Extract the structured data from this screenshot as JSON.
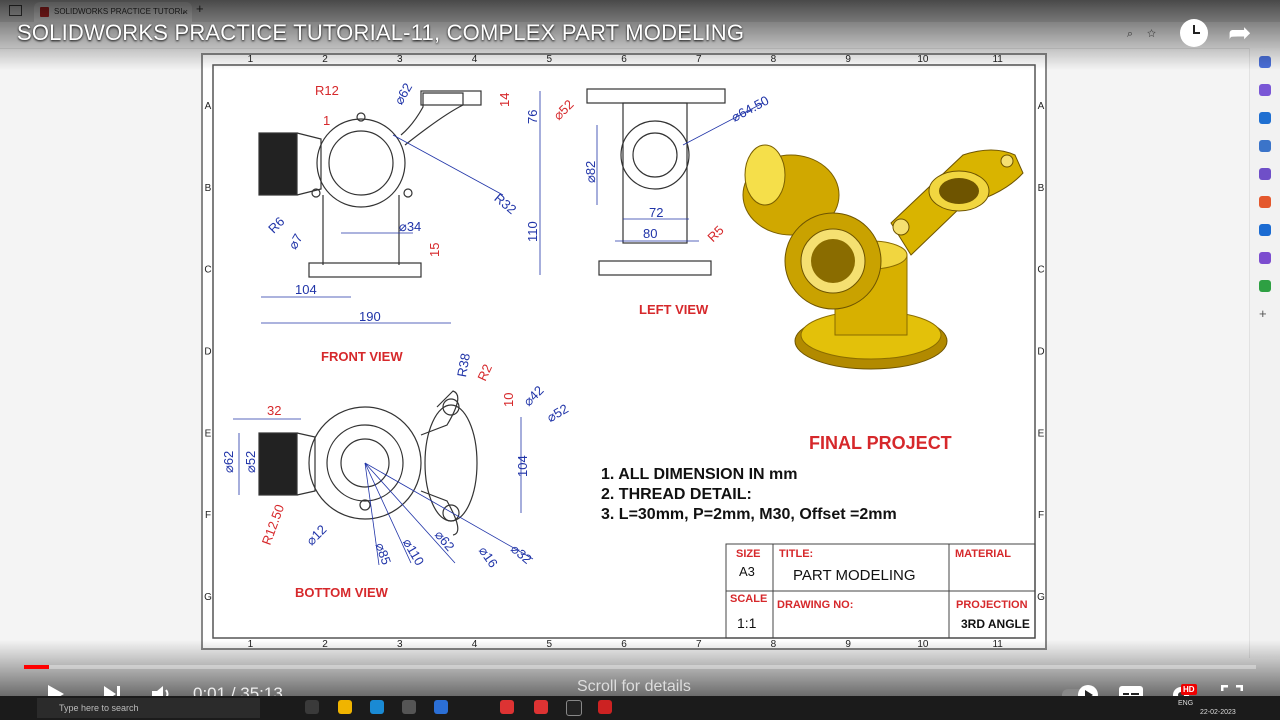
{
  "browser": {
    "tab_title": "SOLIDWORKS PRACTICE TUTORIAL",
    "tab_close": "×",
    "new_tab": "+"
  },
  "video": {
    "title": "SOLIDWORKS PRACTICE TUTORIAL-11, COMPLEX PART MODELING",
    "current_time": "0:01",
    "duration": "35:13",
    "time_separator": " / ",
    "progress_fraction": 0.02,
    "scroll_hint": "Scroll for details",
    "hd_badge": "HD",
    "accent": "#ff0000"
  },
  "drawing": {
    "column_numbers": [
      "1",
      "2",
      "3",
      "4",
      "5",
      "6",
      "7",
      "8",
      "9",
      "10",
      "11"
    ],
    "row_letters": [
      "A",
      "B",
      "C",
      "D",
      "E",
      "F",
      "G"
    ],
    "views": {
      "front": "FRONT VIEW",
      "left": "LEFT VIEW",
      "bottom": "BOTTOM VIEW"
    },
    "dims_front": [
      "R12",
      "⌀62",
      "14",
      "76",
      "R32",
      "110",
      "15",
      "⌀34",
      "R6",
      "⌀7",
      "104",
      "190",
      "1"
    ],
    "dims_left": [
      "⌀52",
      "⌀64.50",
      "⌀82",
      "72",
      "80",
      "R5"
    ],
    "dims_bottom": [
      "32",
      "⌀62",
      "⌀52",
      "R38",
      "R2",
      "⌀42",
      "⌀52",
      "10",
      "104",
      "R12.50",
      "⌀12",
      "⌀85",
      "⌀110",
      "⌀62",
      "⌀16",
      "⌀32"
    ],
    "project_title": "FINAL PROJECT",
    "notes": [
      "1. ALL DIMENSION IN mm",
      "2. THREAD DETAIL:",
      "3. L=30mm, P=2mm, M30, Offset =2mm"
    ],
    "title_block": {
      "size_label": "SIZE",
      "size_value": "A3",
      "title_label": "TITLE:",
      "title_value": "PART MODELING",
      "material_label": "MATERIAL",
      "scale_label": "SCALE",
      "scale_value": "1:1",
      "drawing_no_label": "DRAWING NO:",
      "projection_label": "PROJECTION",
      "projection_value": "3RD ANGLE"
    },
    "colors": {
      "red": "#d6282b",
      "blue": "#2034a8",
      "gold": "#d7b000"
    }
  },
  "taskbar": {
    "search_placeholder": "Type here to search",
    "tray_lang": "ENG",
    "tray_date": "22-02-2023"
  }
}
